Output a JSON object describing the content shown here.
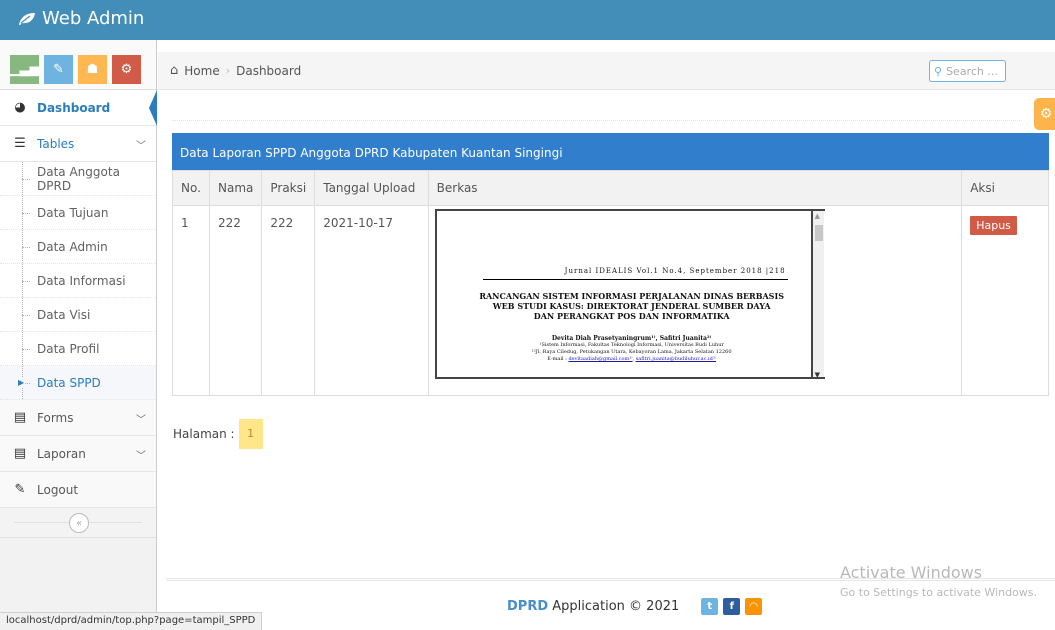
{
  "app": {
    "title": "Web Admin"
  },
  "shortcuts": [
    {
      "icon": "signal-icon",
      "color": "#87b87f"
    },
    {
      "icon": "pencil-icon",
      "color": "#6fb3e0"
    },
    {
      "icon": "users-icon",
      "color": "#ffb752"
    },
    {
      "icon": "cogs-icon",
      "color": "#d15b47"
    }
  ],
  "sidebar": {
    "dashboard": "Dashboard",
    "tables": "Tables",
    "sub_items": [
      "Data Anggota DPRD",
      "Data Tujuan",
      "Data Admin",
      "Data Informasi",
      "Data Visi",
      "Data Profil",
      "Data SPPD"
    ],
    "forms": "Forms",
    "laporan": "Laporan",
    "logout": "Logout"
  },
  "breadcrumb": {
    "home": "Home",
    "current": "Dashboard"
  },
  "search": {
    "placeholder": "Search ..."
  },
  "table": {
    "title": "Data Laporan SPPD Anggota DPRD Kabupaten Kuantan Singingi",
    "headers": [
      "No.",
      "Nama",
      "Praksi",
      "Tanggal Upload",
      "Berkas",
      "Aksi"
    ],
    "rows": [
      {
        "no": "1",
        "nama": "222",
        "praksi": "222",
        "tanggal": "2021-10-17",
        "aksi": "Hapus"
      }
    ]
  },
  "document": {
    "journal": "Jurnal IDEALIS Vol.1 No.4, September 2018 |218",
    "title_lines": [
      "RANCANGAN SISTEM INFORMASI PERJALANAN DINAS BERBASIS",
      "WEB STUDI KASUS: DIREKTORAT JENDERAL SUMBER DAYA",
      "DAN PERANGKAT POS DAN INFORMATIKA"
    ],
    "authors": "Devita Diah Prasetyaningrum¹⁾, Safitri Juanita²⁾",
    "affiliation": "¹Sistem Informasi, Fakultas Teknologi Informasi, Universitas Budi Luhur",
    "address": "¹²Jl. Raya Ciledug, Petukangan Utara, Kebayoran Lama, Jakarta Selatan 12260",
    "email_label": "E-mail :",
    "email1": "devitaadiah@gmail.com¹⁾",
    "email2": "safitri.juanita@budiluhur.ac.id²⁾"
  },
  "pagination": {
    "label": "Halaman :",
    "pages": [
      "1"
    ]
  },
  "footer": {
    "brand": "DPRD",
    "text": "Application © 2021"
  },
  "watermark": {
    "title": "Activate Windows",
    "subtitle": "Go to Settings to activate Windows."
  },
  "status_url": "localhost/dprd/admin/top.php?page=tampil_SPPD"
}
